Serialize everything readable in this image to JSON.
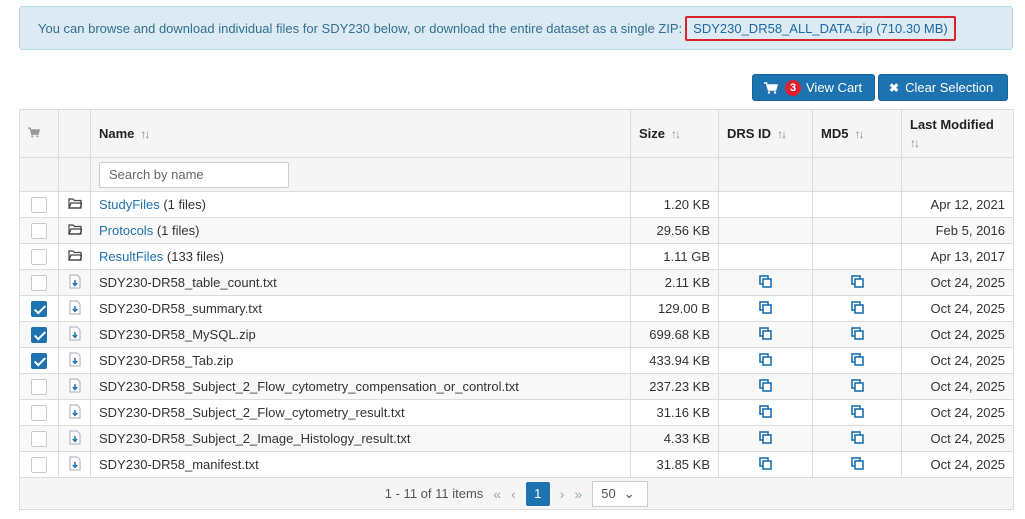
{
  "banner": {
    "text": "You can browse and download individual files for SDY230 below, or download the entire dataset as a single ZIP:",
    "zip_link": "SDY230_DR58_ALL_DATA.zip (710.30 MB)"
  },
  "toolbar": {
    "cart_count": "3",
    "view_cart_label": "View Cart",
    "clear_selection_label": "Clear Selection"
  },
  "table": {
    "columns": {
      "name": "Name",
      "size": "Size",
      "drs_id": "DRS ID",
      "md5": "MD5",
      "last_modified": "Last Modified"
    },
    "search_placeholder": "Search by name",
    "folders": [
      {
        "name": "StudyFiles",
        "count": "(1 files)",
        "size": "1.20 KB",
        "modified": "Apr 12, 2021"
      },
      {
        "name": "Protocols",
        "count": "(1 files)",
        "size": "29.56 KB",
        "modified": "Feb 5, 2016"
      },
      {
        "name": "ResultFiles",
        "count": "(133 files)",
        "size": "1.11 GB",
        "modified": "Apr 13, 2017"
      }
    ],
    "files": [
      {
        "name": "SDY230-DR58_table_count.txt",
        "size": "2.11 KB",
        "modified": "Oct 24, 2025",
        "checked": false
      },
      {
        "name": "SDY230-DR58_summary.txt",
        "size": "129.00 B",
        "modified": "Oct 24, 2025",
        "checked": true
      },
      {
        "name": "SDY230-DR58_MySQL.zip",
        "size": "699.68 KB",
        "modified": "Oct 24, 2025",
        "checked": true
      },
      {
        "name": "SDY230-DR58_Tab.zip",
        "size": "433.94 KB",
        "modified": "Oct 24, 2025",
        "checked": true
      },
      {
        "name": "SDY230-DR58_Subject_2_Flow_cytometry_compensation_or_control.txt",
        "size": "237.23 KB",
        "modified": "Oct 24, 2025",
        "checked": false
      },
      {
        "name": "SDY230-DR58_Subject_2_Flow_cytometry_result.txt",
        "size": "31.16 KB",
        "modified": "Oct 24, 2025",
        "checked": false
      },
      {
        "name": "SDY230-DR58_Subject_2_Image_Histology_result.txt",
        "size": "4.33 KB",
        "modified": "Oct 24, 2025",
        "checked": false
      },
      {
        "name": "SDY230-DR58_manifest.txt",
        "size": "31.85 KB",
        "modified": "Oct 24, 2025",
        "checked": false
      }
    ]
  },
  "pager": {
    "summary": "1 - 11 of 11 items",
    "current_page": "1",
    "page_size": "50"
  },
  "colors": {
    "primary": "#1d72b0",
    "badge": "#e0202e",
    "banner_bg": "#dbeaf3",
    "highlight_border": "#d9232a"
  }
}
